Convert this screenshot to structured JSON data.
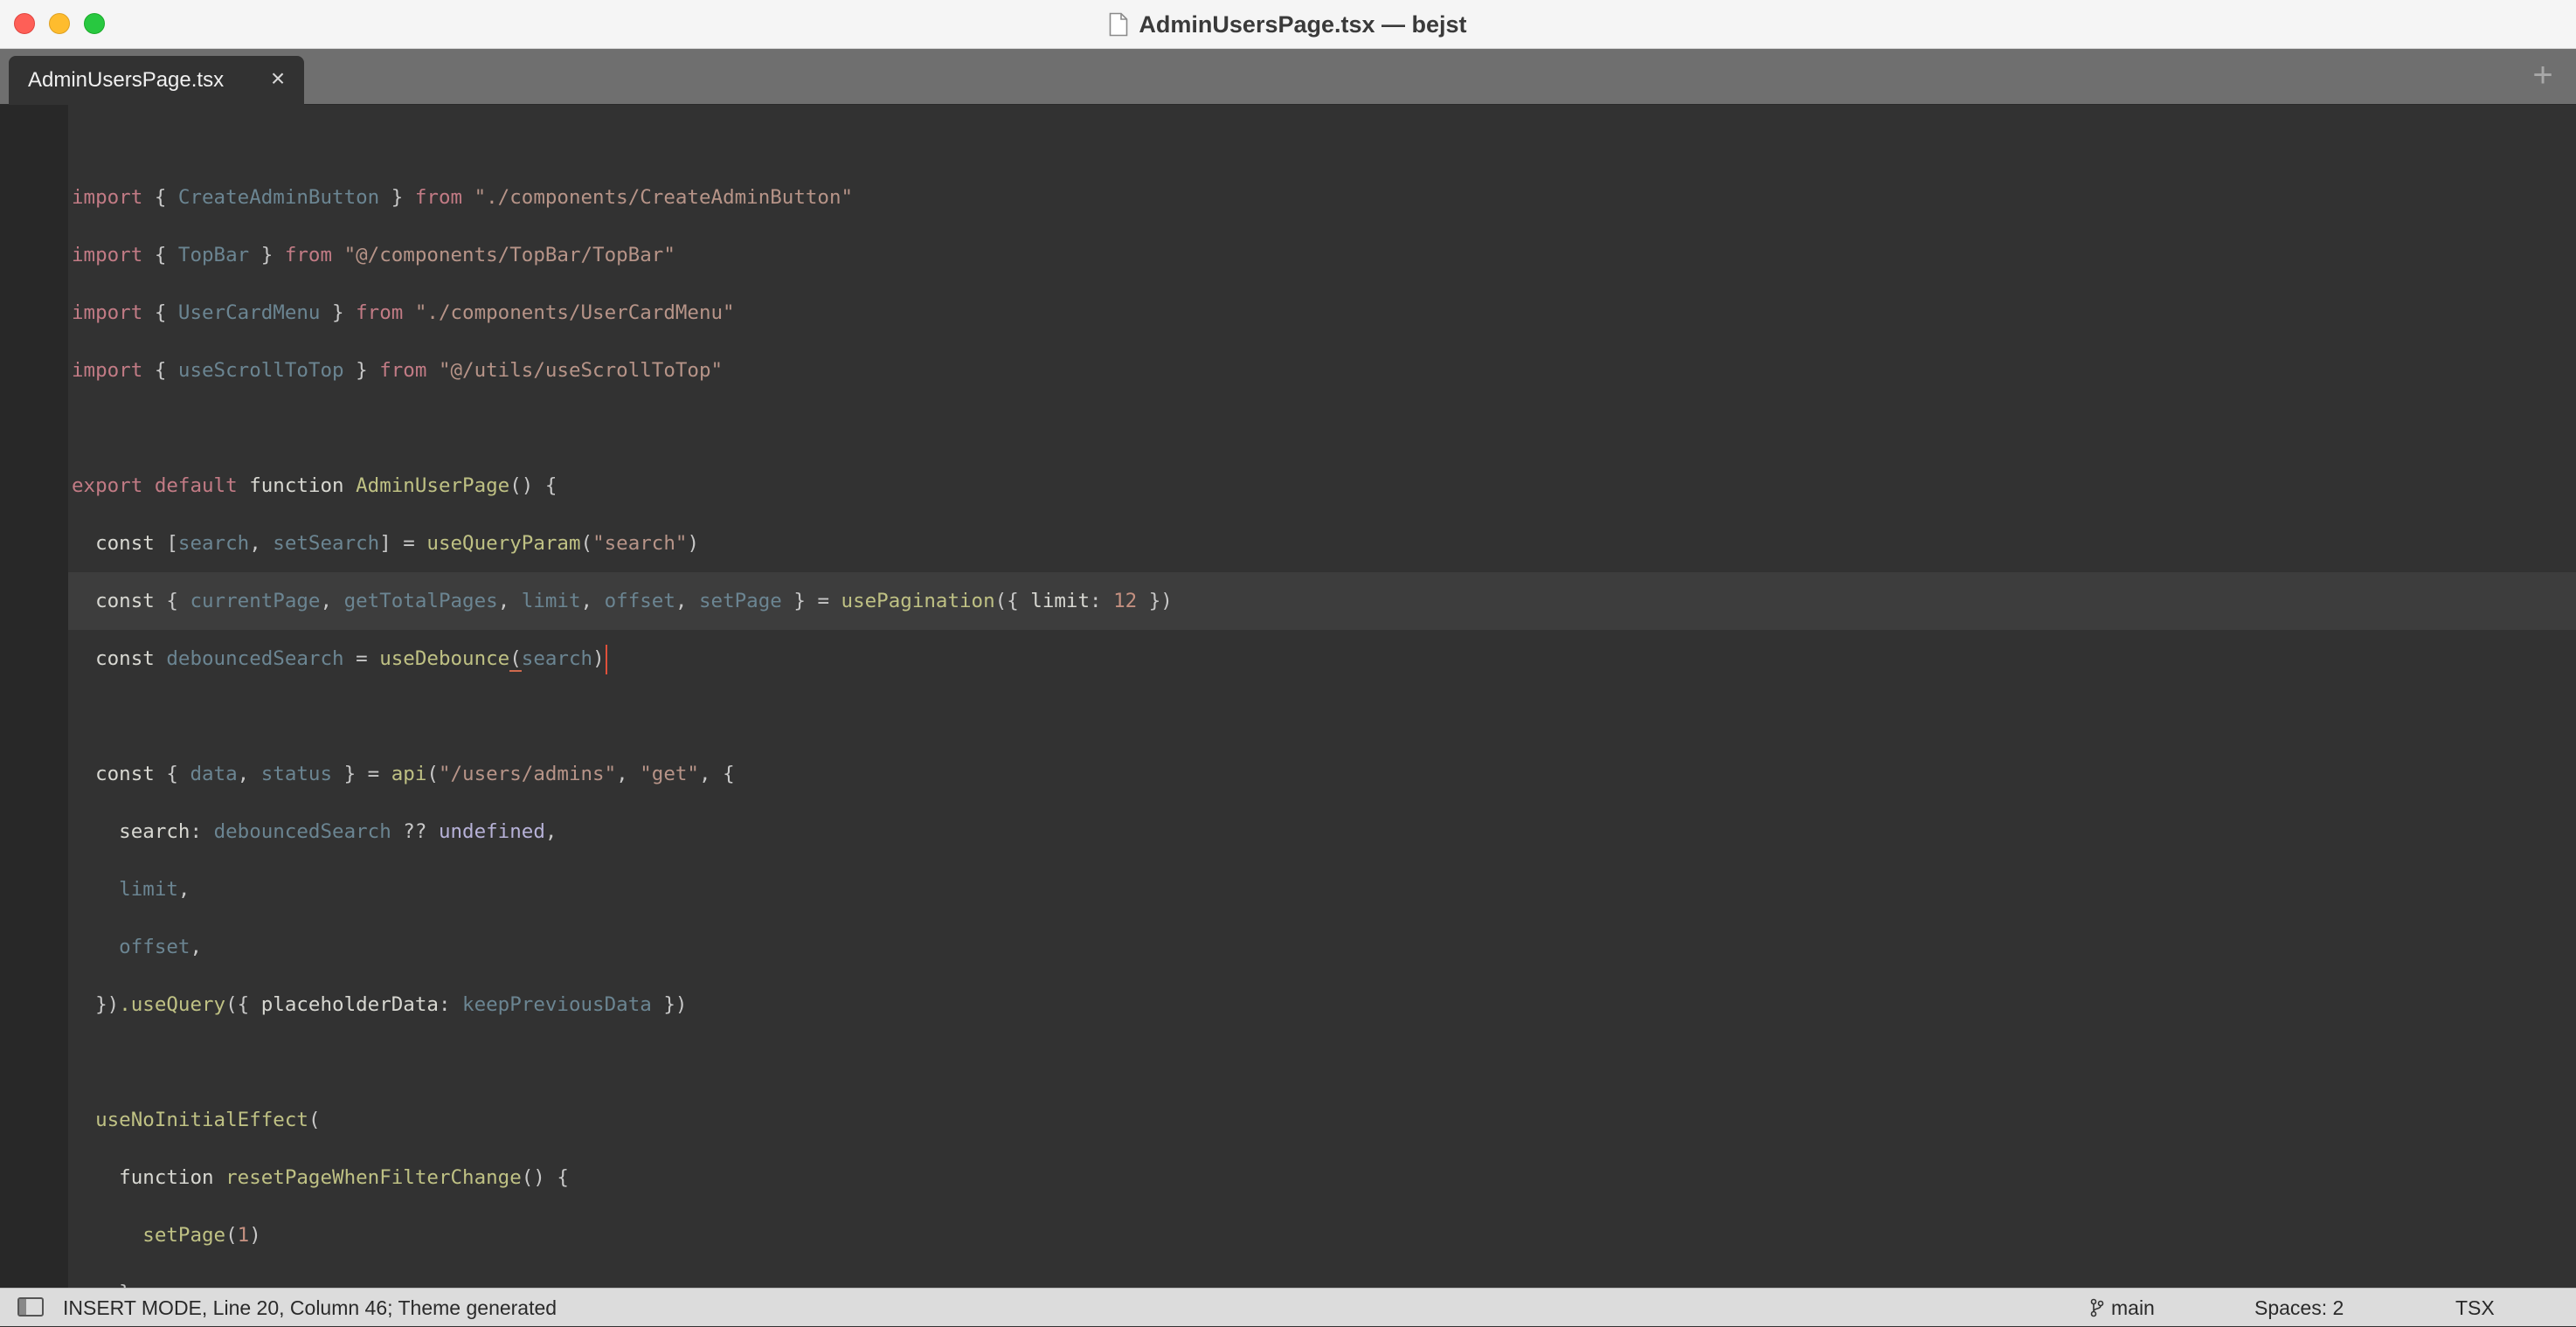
{
  "window": {
    "title": "AdminUsersPage.tsx — bejst"
  },
  "tabs": [
    {
      "label": "AdminUsersPage.tsx",
      "close_glyph": "×"
    }
  ],
  "tab_add_glyph": "+",
  "editor": {
    "active_line_index": 8,
    "lines": [
      [],
      [
        [
          "kw",
          "import"
        ],
        [
          "punc",
          " { "
        ],
        [
          "ident",
          "CreateAdminButton"
        ],
        [
          "punc",
          " } "
        ],
        [
          "kw",
          "from"
        ],
        [
          "punc",
          " "
        ],
        [
          "str",
          "\"./components/CreateAdminButton\""
        ]
      ],
      [
        [
          "kw",
          "import"
        ],
        [
          "punc",
          " { "
        ],
        [
          "ident",
          "TopBar"
        ],
        [
          "punc",
          " } "
        ],
        [
          "kw",
          "from"
        ],
        [
          "punc",
          " "
        ],
        [
          "str",
          "\"@/components/TopBar/TopBar\""
        ]
      ],
      [
        [
          "kw",
          "import"
        ],
        [
          "punc",
          " { "
        ],
        [
          "ident",
          "UserCardMenu"
        ],
        [
          "punc",
          " } "
        ],
        [
          "kw",
          "from"
        ],
        [
          "punc",
          " "
        ],
        [
          "str",
          "\"./components/UserCardMenu\""
        ]
      ],
      [
        [
          "kw",
          "import"
        ],
        [
          "punc",
          " { "
        ],
        [
          "ident",
          "useScrollToTop"
        ],
        [
          "punc",
          " } "
        ],
        [
          "kw",
          "from"
        ],
        [
          "punc",
          " "
        ],
        [
          "str",
          "\"@/utils/useScrollToTop\""
        ]
      ],
      [],
      [
        [
          "kw",
          "export"
        ],
        [
          "plain",
          " "
        ],
        [
          "kw",
          "default"
        ],
        [
          "plain",
          " function "
        ],
        [
          "fn",
          "AdminUserPage"
        ],
        [
          "punc",
          "() {"
        ]
      ],
      [
        [
          "plain",
          "  const "
        ],
        [
          "punc",
          "["
        ],
        [
          "ident",
          "search"
        ],
        [
          "punc",
          ", "
        ],
        [
          "ident",
          "setSearch"
        ],
        [
          "punc",
          "] = "
        ],
        [
          "fn",
          "useQueryParam"
        ],
        [
          "punc",
          "("
        ],
        [
          "str",
          "\"search\""
        ],
        [
          "punc",
          ")"
        ]
      ],
      [
        [
          "plain",
          "  const "
        ],
        [
          "punc",
          "{ "
        ],
        [
          "ident",
          "currentPage"
        ],
        [
          "punc",
          ", "
        ],
        [
          "ident",
          "getTotalPages"
        ],
        [
          "punc",
          ", "
        ],
        [
          "ident",
          "limit"
        ],
        [
          "punc",
          ", "
        ],
        [
          "ident",
          "offset"
        ],
        [
          "punc",
          ", "
        ],
        [
          "ident",
          "setPage"
        ],
        [
          "punc",
          " } = "
        ],
        [
          "fn",
          "usePagination"
        ],
        [
          "punc",
          "({ "
        ],
        [
          "plain",
          "limit"
        ],
        [
          "punc",
          ": "
        ],
        [
          "num",
          "12"
        ],
        [
          "punc",
          " })"
        ]
      ],
      [
        [
          "plain",
          "  const "
        ],
        [
          "ident",
          "debouncedSearch"
        ],
        [
          "punc",
          " = "
        ],
        [
          "fn",
          "useDebounce"
        ],
        [
          "sq",
          "("
        ],
        [
          "ident",
          "search"
        ],
        [
          "punc",
          ")"
        ],
        [
          "cursor",
          ""
        ]
      ],
      [],
      [
        [
          "plain",
          "  const "
        ],
        [
          "punc",
          "{ "
        ],
        [
          "ident",
          "data"
        ],
        [
          "punc",
          ", "
        ],
        [
          "ident",
          "status"
        ],
        [
          "punc",
          " } = "
        ],
        [
          "fn",
          "api"
        ],
        [
          "punc",
          "("
        ],
        [
          "str",
          "\"/users/admins\""
        ],
        [
          "punc",
          ", "
        ],
        [
          "str",
          "\"get\""
        ],
        [
          "punc",
          ", {"
        ]
      ],
      [
        [
          "plain",
          "    search"
        ],
        [
          "punc",
          ": "
        ],
        [
          "ident",
          "debouncedSearch"
        ],
        [
          "punc",
          " ?? "
        ],
        [
          "special",
          "undefined"
        ],
        [
          "punc",
          ","
        ]
      ],
      [
        [
          "ident",
          "    limit"
        ],
        [
          "punc",
          ","
        ]
      ],
      [
        [
          "ident",
          "    offset"
        ],
        [
          "punc",
          ","
        ]
      ],
      [
        [
          "punc",
          "  })"
        ],
        [
          "fn",
          ".useQuery"
        ],
        [
          "punc",
          "({ "
        ],
        [
          "plain",
          "placeholderData"
        ],
        [
          "punc",
          ": "
        ],
        [
          "ident",
          "keepPreviousData"
        ],
        [
          "punc",
          " })"
        ]
      ],
      [],
      [
        [
          "fn",
          "  useNoInitialEffect"
        ],
        [
          "punc",
          "("
        ]
      ],
      [
        [
          "plain",
          "    function "
        ],
        [
          "fn",
          "resetPageWhenFilterChange"
        ],
        [
          "punc",
          "() {"
        ]
      ],
      [
        [
          "fn",
          "      setPage"
        ],
        [
          "punc",
          "("
        ],
        [
          "num",
          "1"
        ],
        [
          "punc",
          ")"
        ]
      ],
      [
        [
          "punc",
          "    },"
        ]
      ]
    ]
  },
  "status": {
    "mode_text": "INSERT MODE, Line 20, Column 46; Theme generated",
    "branch": "main",
    "spaces": "Spaces: 2",
    "syntax": "TSX"
  }
}
